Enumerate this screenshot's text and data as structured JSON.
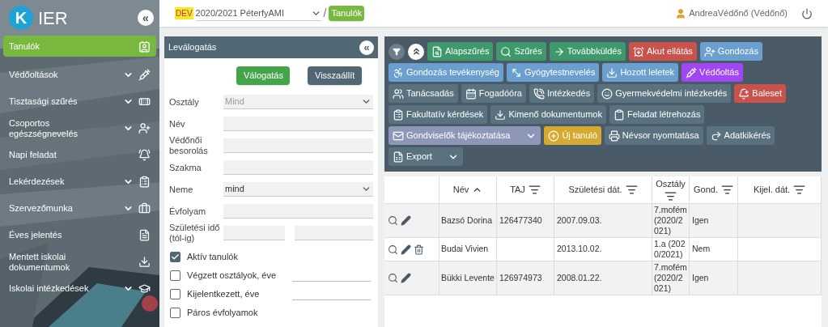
{
  "logo": {
    "mark": "K",
    "name": "IER"
  },
  "sidebar": {
    "collapse": "«",
    "items": [
      {
        "label": "Tanulók",
        "selected": true,
        "expandable": false
      },
      {
        "label": "Védőoltások",
        "selected": false,
        "expandable": true
      },
      {
        "label": "Tisztasági szűrés",
        "selected": false,
        "expandable": true
      },
      {
        "label": "Csoportos egészségnevelés",
        "selected": false,
        "expandable": true
      },
      {
        "label": "Napi feladat",
        "selected": false,
        "expandable": false
      },
      {
        "label": "Lekérdezések",
        "selected": false,
        "expandable": true
      },
      {
        "label": "Szervezőmunka",
        "selected": false,
        "expandable": true
      },
      {
        "label": "Éves jelentés",
        "selected": false,
        "expandable": false
      },
      {
        "label": "Mentett iskolai dokumentumok",
        "selected": false,
        "expandable": false
      },
      {
        "label": "Iskolai intézkedések",
        "selected": false,
        "expandable": true
      }
    ]
  },
  "header": {
    "env": "DEV",
    "school": "2020/2021 PéterfyAMI",
    "separator": "/",
    "crumb": "Tanulók",
    "user": "AndreaVédőnő (Védőnő)"
  },
  "filter": {
    "title": "Leválogatás",
    "collapse": "«",
    "buttons": [
      {
        "label": "Válogatás",
        "kind": "primary"
      },
      {
        "label": "Visszaállít",
        "kind": "secondary"
      }
    ],
    "fields": [
      {
        "label": "Osztály",
        "kind": "select",
        "placeholder": "Mind"
      },
      {
        "label": "Név",
        "kind": "text"
      },
      {
        "label": "Védőnői besorolás",
        "kind": "text"
      },
      {
        "label": "Szakma",
        "kind": "text"
      },
      {
        "label": "Neme",
        "kind": "select",
        "value": "mind"
      },
      {
        "label": "Évfolyam",
        "kind": "text"
      },
      {
        "label": "Születési idő (tól-ig)",
        "kind": "range"
      }
    ],
    "checks": [
      {
        "label": "Aktív tanulók",
        "checked": true,
        "has_year": false
      },
      {
        "label": "Végzett osztályok, éve",
        "checked": false,
        "has_year": true
      },
      {
        "label": "Kijelentkezett, éve",
        "checked": false,
        "has_year": true
      },
      {
        "label": "Páros évfolyamok",
        "checked": false,
        "has_year": false
      }
    ]
  },
  "toolbar": {
    "buttons": [
      {
        "label": "Alapszűrés",
        "color": "#3e9a6b"
      },
      {
        "label": "Szűrés",
        "color": "#3e9a6b"
      },
      {
        "label": "Továbbküldés",
        "color": "#3e9a6b"
      },
      {
        "label": "Akut ellátás",
        "color": "#c9534a"
      },
      {
        "label": "Gondozás",
        "color": "#6b9fcf"
      },
      {
        "label": "Gondozás tevékenység",
        "color": "#6b9fcf"
      },
      {
        "label": "Gyógytestnevelés",
        "color": "#6b9fcf"
      },
      {
        "label": "Hozott leletek",
        "color": "#6b9fcf"
      },
      {
        "label": "Védőoltás",
        "color": "#a046f2"
      },
      {
        "label": "Tanácsadás",
        "color": "#5a7280"
      },
      {
        "label": "Fogadóóra",
        "color": "#5a7280"
      },
      {
        "label": "Intézkedés",
        "color": "#5a7280"
      },
      {
        "label": "Gyermekvédelmi intézkedés",
        "color": "#5a7280"
      },
      {
        "label": "Baleset",
        "color": "#c9534a"
      },
      {
        "label": "Fakultatív kérdések",
        "color": "#5a7280"
      },
      {
        "label": "Kimenő dokumentumok",
        "color": "#5a7280"
      },
      {
        "label": "Feladat létrehozás",
        "color": "#5a7280"
      },
      {
        "label": "Gondviselők tájékoztatása",
        "color": "#8d98b8",
        "kind": "dropdown"
      },
      {
        "label": "Új tanuló",
        "color": "#d5aa30"
      },
      {
        "label": "Névsor nyomtatása",
        "color": "#5a7280"
      },
      {
        "label": "Adatkikérés",
        "color": "#5a7280"
      },
      {
        "label": "Export",
        "color": "#5a7280",
        "kind": "dropdown"
      }
    ]
  },
  "table": {
    "columns": [
      {
        "label": "Név",
        "sorted": true
      },
      {
        "label": "TAJ",
        "sorted": false
      },
      {
        "label": "Születési dát.",
        "sorted": false
      },
      {
        "label": "Osztály",
        "sorted": false
      },
      {
        "label": "Gond.",
        "sorted": false
      },
      {
        "label": "Kijel. dát.",
        "sorted": false
      }
    ],
    "rows": [
      {
        "deletable": false,
        "cells": [
          "Bazsó Dorina",
          "126477340",
          "2007.09.03.",
          "7.mofém (2020/2021)",
          "Igen",
          ""
        ]
      },
      {
        "deletable": true,
        "cells": [
          "Budai Vivien",
          "",
          "2013.10.02.",
          "1.a (2020/2021)",
          "Nem",
          ""
        ]
      },
      {
        "deletable": false,
        "cells": [
          "Bükki Levente",
          "126974973",
          "2008.01.22.",
          "7.mofém (2020/2021)",
          "Igen",
          ""
        ]
      }
    ]
  }
}
